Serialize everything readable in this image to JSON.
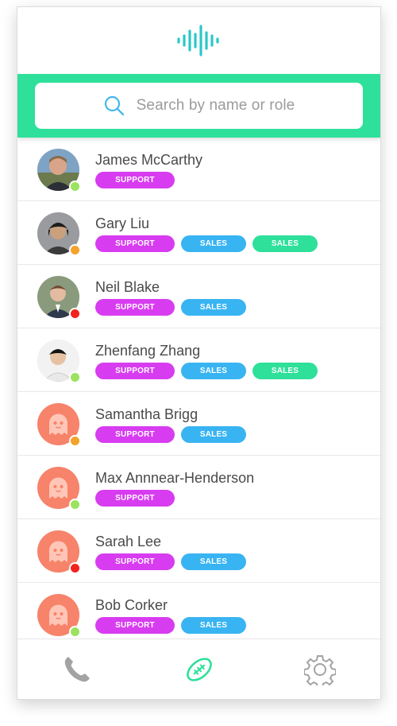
{
  "search": {
    "placeholder": "Search by name or role"
  },
  "colors": {
    "accent": "#2ee09a",
    "support": "#d83cf0",
    "sales_blue": "#39b4f2",
    "sales_green": "#2ee09a",
    "status_online": "#9be35f",
    "status_away": "#f4a22a",
    "status_busy": "#f2231e",
    "ghost_avatar": "#f7836a"
  },
  "contacts": [
    {
      "name": "James McCarthy",
      "status": "online",
      "avatar": "photo-james",
      "tags": [
        {
          "label": "SUPPORT",
          "color": "support"
        }
      ]
    },
    {
      "name": "Gary Liu",
      "status": "away",
      "avatar": "photo-gary",
      "tags": [
        {
          "label": "SUPPORT",
          "color": "support"
        },
        {
          "label": "SALES",
          "color": "sales_blue"
        },
        {
          "label": "SALES",
          "color": "sales_green"
        }
      ]
    },
    {
      "name": "Neil Blake",
      "status": "busy",
      "avatar": "photo-neil",
      "tags": [
        {
          "label": "SUPPORT",
          "color": "support"
        },
        {
          "label": "SALES",
          "color": "sales_blue"
        }
      ]
    },
    {
      "name": "Zhenfang Zhang",
      "status": "online",
      "avatar": "photo-zhenfang",
      "tags": [
        {
          "label": "SUPPORT",
          "color": "support"
        },
        {
          "label": "SALES",
          "color": "sales_blue"
        },
        {
          "label": "SALES",
          "color": "sales_green"
        }
      ]
    },
    {
      "name": "Samantha Brigg",
      "status": "away",
      "avatar": "ghost-icon",
      "tags": [
        {
          "label": "SUPPORT",
          "color": "support"
        },
        {
          "label": "SALES",
          "color": "sales_blue"
        }
      ]
    },
    {
      "name": "Max Annnear-Henderson",
      "status": "online",
      "avatar": "ghost-icon",
      "tags": [
        {
          "label": "SUPPORT",
          "color": "support"
        }
      ]
    },
    {
      "name": "Sarah Lee",
      "status": "busy",
      "avatar": "ghost-icon",
      "tags": [
        {
          "label": "SUPPORT",
          "color": "support"
        },
        {
          "label": "SALES",
          "color": "sales_blue"
        }
      ]
    },
    {
      "name": "Bob Corker",
      "status": "online",
      "avatar": "ghost-icon",
      "tags": [
        {
          "label": "SUPPORT",
          "color": "support"
        },
        {
          "label": "SALES",
          "color": "sales_blue"
        }
      ]
    }
  ],
  "tabbar": {
    "items": [
      {
        "icon": "phone-icon",
        "active": false
      },
      {
        "icon": "football-icon",
        "active": true
      },
      {
        "icon": "gear-icon",
        "active": false
      }
    ]
  }
}
